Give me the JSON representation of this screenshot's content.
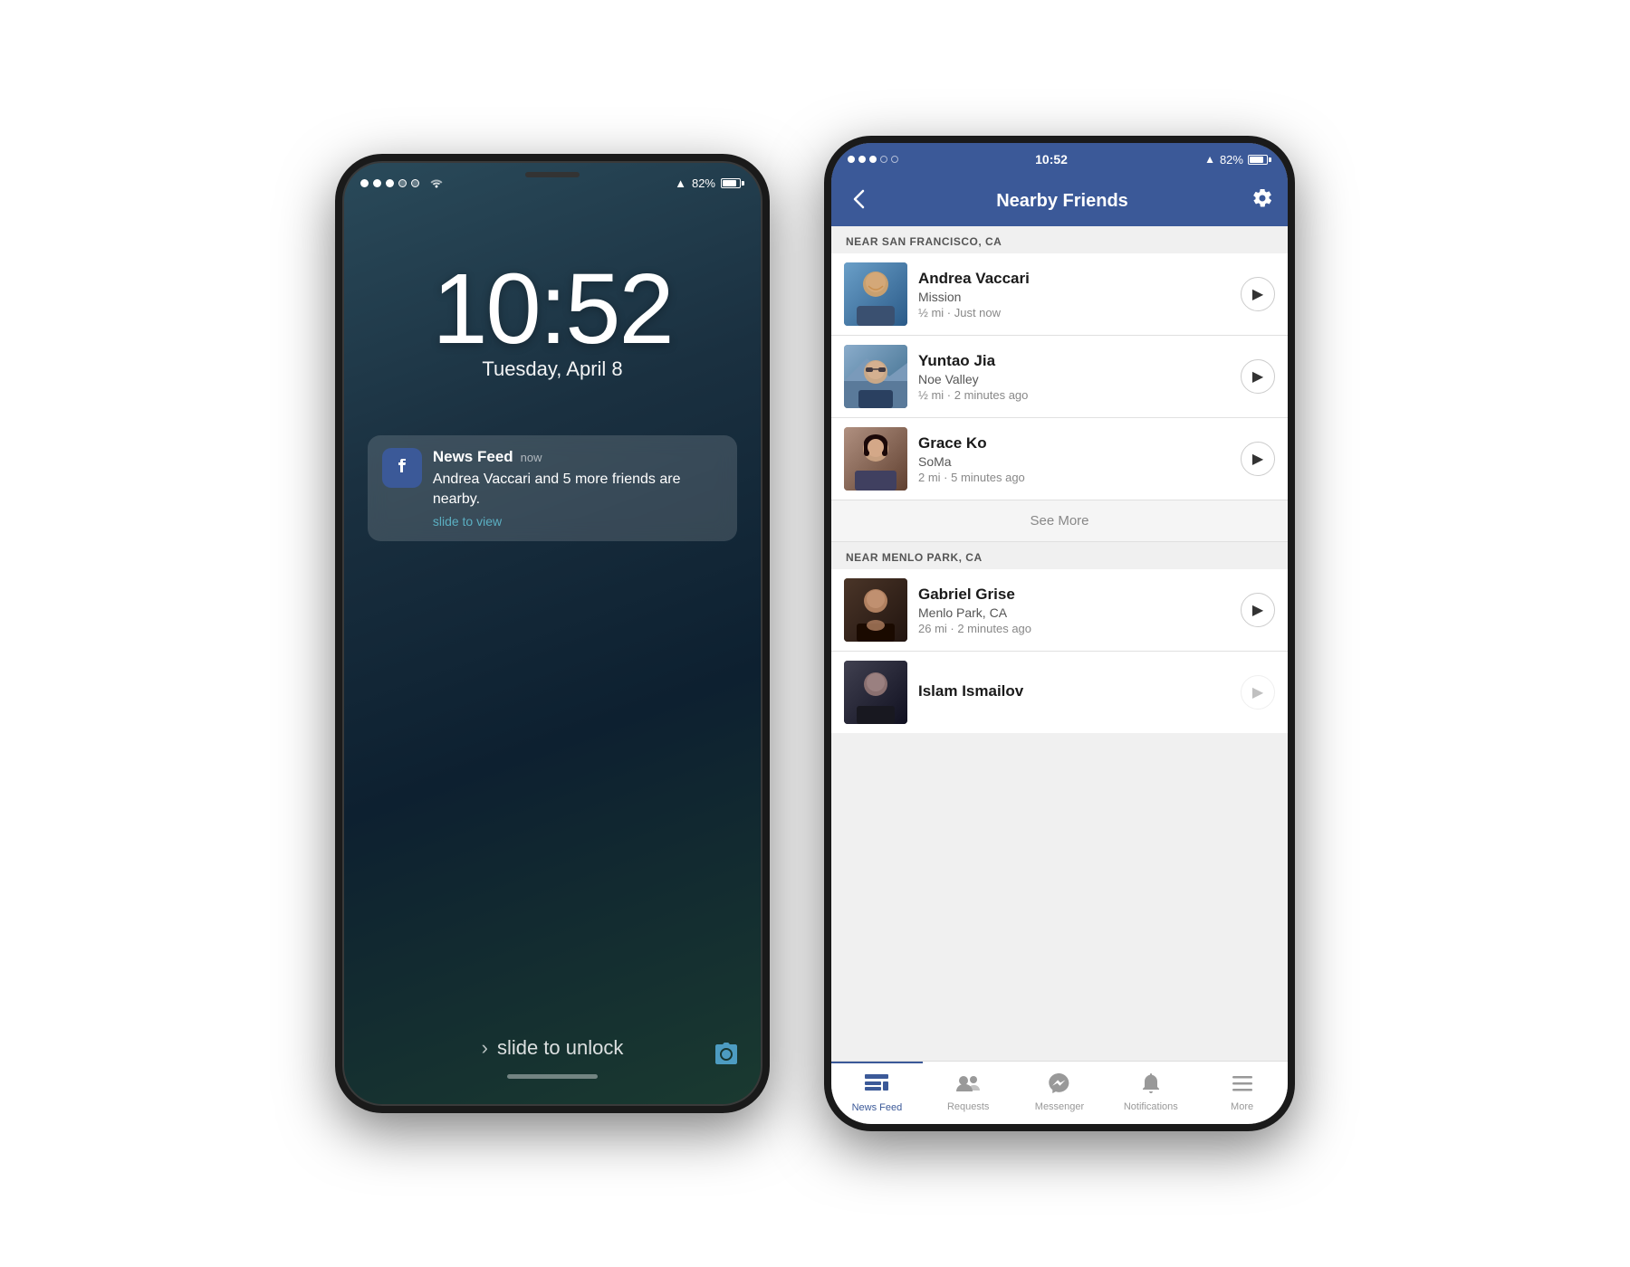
{
  "lock_screen": {
    "status_bar": {
      "dots": [
        "filled",
        "filled",
        "filled",
        "empty",
        "empty"
      ],
      "wifi": "wifi",
      "location": "▲",
      "battery_pct": "82%",
      "speaker_indicator": true
    },
    "time": "10:52",
    "date": "Tuesday, April 8",
    "notification": {
      "app_name": "Facebook",
      "time_label": "now",
      "message": "Andrea Vaccari and 5 more friends are nearby.",
      "slide_label": "slide to view"
    },
    "slide_unlock": "slide to unlock",
    "camera_icon": "📷"
  },
  "fb_screen": {
    "status_bar": {
      "dots": [
        "filled",
        "filled",
        "filled",
        "empty",
        "empty"
      ],
      "time": "10:52",
      "location": "▲",
      "battery_pct": "82%"
    },
    "header": {
      "back_label": "‹",
      "title": "Nearby Friends",
      "settings_icon": "⚙"
    },
    "sections": [
      {
        "section_id": "sf",
        "header": "NEAR SAN FRANCISCO, CA",
        "friends": [
          {
            "name": "Andrea Vaccari",
            "location": "Mission",
            "meta": "½ mi · Just now",
            "avatar_class": "avatar-andrea"
          },
          {
            "name": "Yuntao Jia",
            "location": "Noe Valley",
            "meta": "½ mi · 2 minutes ago",
            "avatar_class": "avatar-yuntao"
          },
          {
            "name": "Grace Ko",
            "location": "SoMa",
            "meta": "2 mi · 5 minutes ago",
            "avatar_class": "avatar-grace"
          }
        ],
        "see_more": "See More"
      },
      {
        "section_id": "mp",
        "header": "NEAR MENLO PARK, CA",
        "friends": [
          {
            "name": "Gabriel Grise",
            "location": "Menlo Park, CA",
            "meta": "26 mi · 2 minutes ago",
            "avatar_class": "avatar-gabriel"
          },
          {
            "name": "Islam Ismailov",
            "location": "",
            "meta": "",
            "avatar_class": "avatar-islam"
          }
        ]
      }
    ],
    "tab_bar": {
      "tabs": [
        {
          "id": "news-feed",
          "label": "News Feed",
          "icon": "news_feed",
          "active": true
        },
        {
          "id": "requests",
          "label": "Requests",
          "icon": "requests",
          "active": false
        },
        {
          "id": "messenger",
          "label": "Messenger",
          "icon": "messenger",
          "active": false
        },
        {
          "id": "notifications",
          "label": "Notifications",
          "icon": "notifications",
          "active": false
        },
        {
          "id": "more",
          "label": "More",
          "icon": "more",
          "active": false
        }
      ]
    }
  }
}
